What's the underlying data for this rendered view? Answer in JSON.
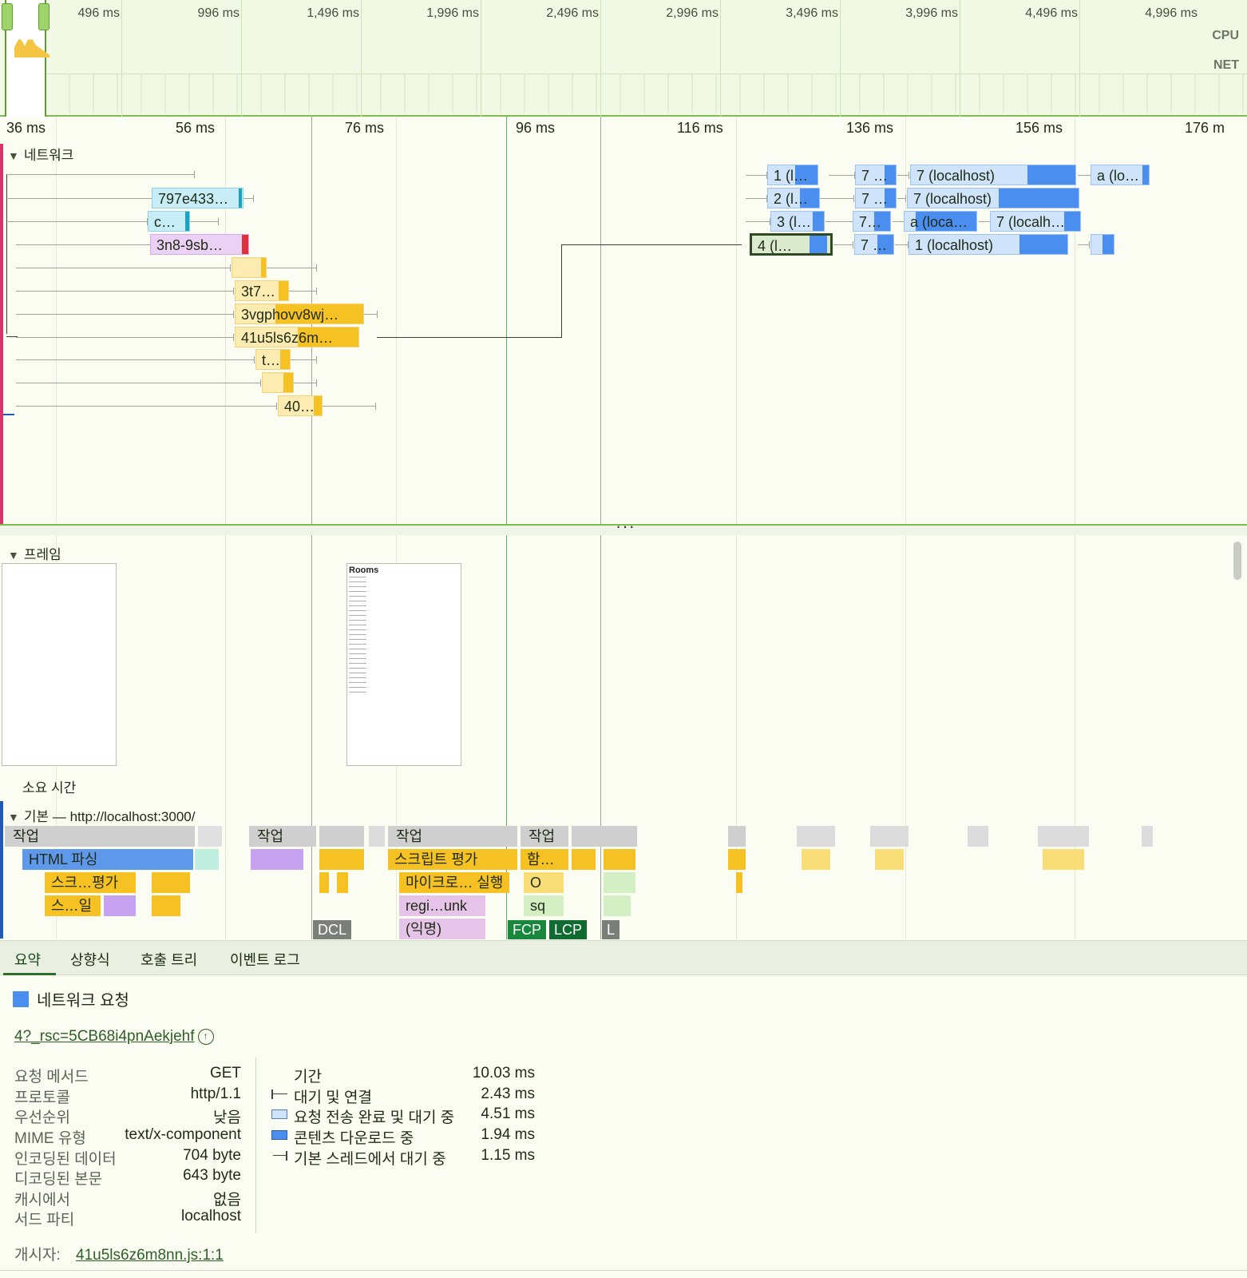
{
  "overview": {
    "labels": [
      "496 ms",
      "996 ms",
      "1,496 ms",
      "1,996 ms",
      "2,496 ms",
      "2,996 ms",
      "3,496 ms",
      "3,996 ms",
      "4,496 ms",
      "4,996 ms"
    ],
    "cpu_label": "CPU",
    "net_label": "NET"
  },
  "ruler": {
    "labels": [
      "36 ms",
      "56 ms",
      "76 ms",
      "96 ms",
      "116 ms",
      "136 ms",
      "156 ms",
      "176 m"
    ]
  },
  "network": {
    "title": "네트워크",
    "requests": {
      "r1": "797e433…",
      "r2": "c…",
      "r3": "3n8-9sb…",
      "r5": "3t7…",
      "r6": "3vgphovv8wj…",
      "r7": "41u5ls6z6m…",
      "r8": "t…",
      "r10": "40…",
      "b1": "1 (l…",
      "b2": "2 (l…",
      "b3": "3 (l…",
      "b4": "4 (l…",
      "c1": "7 …",
      "c2": "7 …",
      "c3": "7…",
      "c4": "7 …",
      "d1": "7 (localhost)",
      "d2": "7 (localhost)",
      "d3": "a (loca…",
      "d3b": "7 (localh…",
      "d4": "1 (localhost)",
      "e1": "a (lo…"
    }
  },
  "frames": {
    "title": "프레임",
    "frame2_title": "Rooms"
  },
  "duration_label": "소요 시간",
  "main_thread": {
    "title": "기본 — http://localhost:3000/",
    "task": "작업",
    "html_parse": "HTML 파싱",
    "script_eval": "스크립트 평가",
    "func": "함…",
    "sub_eval": "스크…평가",
    "microtask": "마이크로… 실행",
    "o": "O",
    "sub2": "스…일",
    "regi": "regi…unk",
    "sq": "sq",
    "anon": "(익명)",
    "markers": {
      "dcl": "DCL",
      "fcp": "FCP",
      "lcp": "LCP",
      "l": "L"
    }
  },
  "tabs": [
    "요약",
    "상향식",
    "호출 트리",
    "이벤트 로그"
  ],
  "summary": {
    "title": "네트워크 요청",
    "color": "#4a8ef0",
    "url": "4?_rsc=5CB68i4pnAekjehf",
    "details": [
      {
        "k": "요청 메서드",
        "v": "GET"
      },
      {
        "k": "프로토콜",
        "v": "http/1.1"
      },
      {
        "k": "우선순위",
        "v": "낮음"
      },
      {
        "k": "MIME 유형",
        "v": "text/x-component"
      },
      {
        "k": "인코딩된 데이터",
        "v": "704 byte"
      },
      {
        "k": "디코딩된 본문",
        "v": "643 byte"
      },
      {
        "k": "캐시에서",
        "v": "없음"
      },
      {
        "k": "서드 파티",
        "v": "localhost"
      }
    ],
    "timing": [
      {
        "k": "기간",
        "v": "10.03 ms"
      },
      {
        "k": "대기 및 연결",
        "v": "2.43 ms"
      },
      {
        "k": "요청 전송 완료 및 대기 중",
        "v": "4.51 ms"
      },
      {
        "k": "콘텐츠 다운로드 중",
        "v": "1.94 ms"
      },
      {
        "k": "기본 스레드에서 대기 중",
        "v": "1.15 ms"
      }
    ],
    "initiator_label": "개시자:",
    "initiator_link": "41u5ls6z6m8nn.js:1:1"
  }
}
